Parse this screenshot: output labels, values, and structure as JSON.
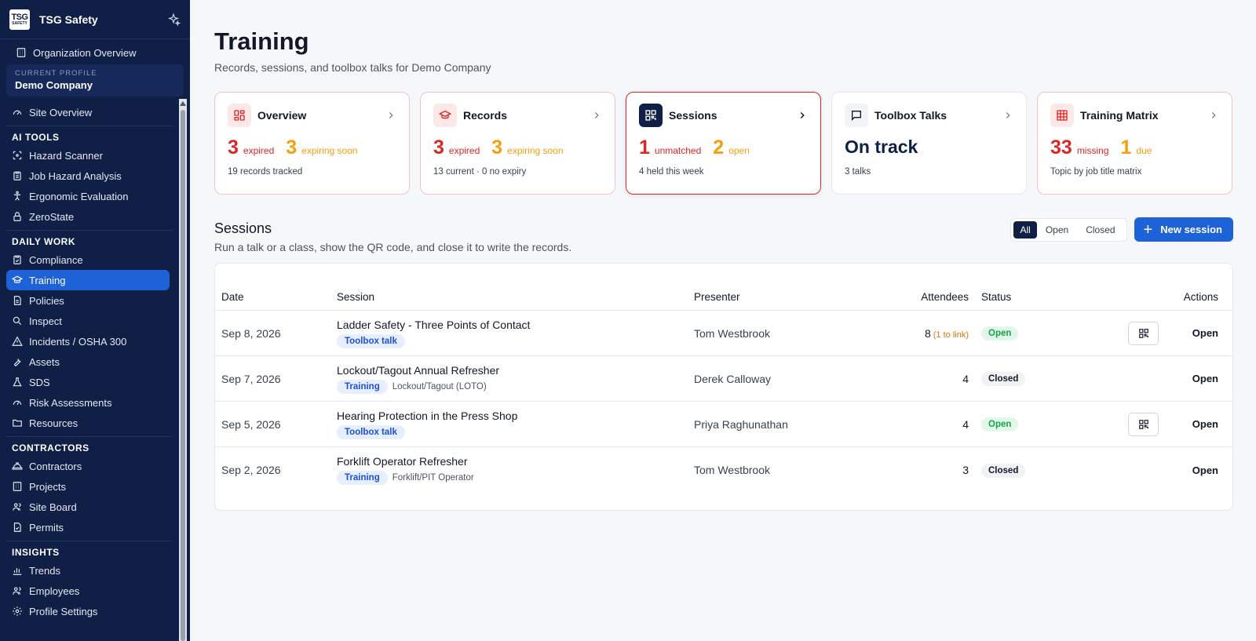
{
  "sidebar": {
    "brand_logo_top": "TSG",
    "brand_logo_bottom": "SAFETY",
    "brand_name": "TSG Safety",
    "org_overview": "Organization Overview",
    "profile_label": "CURRENT PROFILE",
    "profile_name": "Demo Company",
    "site_overview": "Site Overview",
    "sections": {
      "ai_tools": "AI TOOLS",
      "daily_work": "DAILY WORK",
      "contractors": "CONTRACTORS",
      "insights": "INSIGHTS"
    },
    "items": {
      "hazard_scanner": "Hazard Scanner",
      "job_hazard": "Job Hazard Analysis",
      "ergonomic": "Ergonomic Evaluation",
      "zerostate": "ZeroState",
      "compliance": "Compliance",
      "training": "Training",
      "policies": "Policies",
      "inspect": "Inspect",
      "incidents": "Incidents / OSHA 300",
      "assets": "Assets",
      "sds": "SDS",
      "risk": "Risk Assessments",
      "resources": "Resources",
      "contractors": "Contractors",
      "projects": "Projects",
      "site_board": "Site Board",
      "permits": "Permits",
      "trends": "Trends",
      "employees": "Employees",
      "profile_settings": "Profile Settings"
    }
  },
  "page": {
    "title": "Training",
    "subtitle": "Records, sessions, and toolbox talks for Demo Company"
  },
  "cards": {
    "overview": {
      "title": "Overview",
      "n1": "3",
      "l1": "expired",
      "n2": "3",
      "l2": "expiring soon",
      "foot": "19 records tracked"
    },
    "records": {
      "title": "Records",
      "n1": "3",
      "l1": "expired",
      "n2": "3",
      "l2": "expiring soon",
      "foot": "13 current · 0 no expiry"
    },
    "sessions": {
      "title": "Sessions",
      "n1": "1",
      "l1": "unmatched",
      "n2": "2",
      "l2": "open",
      "foot": "4 held this week"
    },
    "toolbox": {
      "title": "Toolbox Talks",
      "status": "On track",
      "foot": "3 talks"
    },
    "matrix": {
      "title": "Training Matrix",
      "n1": "33",
      "l1": "missing",
      "n2": "1",
      "l2": "due",
      "foot": "Topic by job title matrix"
    }
  },
  "sessions": {
    "title": "Sessions",
    "subtitle": "Run a talk or a class, show the QR code, and close it to write the records.",
    "filters": {
      "all": "All",
      "open": "Open",
      "closed": "Closed"
    },
    "new_button": "New session",
    "columns": {
      "date": "Date",
      "session": "Session",
      "presenter": "Presenter",
      "attendees": "Attendees",
      "status": "Status",
      "actions": "Actions"
    },
    "rows": [
      {
        "date": "Sep 8, 2026",
        "title": "Ladder Safety - Three Points of Contact",
        "tag": "Toolbox talk",
        "extra": "",
        "presenter": "Tom Westbrook",
        "attendees": "8",
        "link_note": "(1 to link)",
        "status": "Open",
        "action": "Open"
      },
      {
        "date": "Sep 7, 2026",
        "title": "Lockout/Tagout Annual Refresher",
        "tag": "Training",
        "extra": "Lockout/Tagout (LOTO)",
        "presenter": "Derek Calloway",
        "attendees": "4",
        "link_note": "",
        "status": "Closed",
        "action": "Open"
      },
      {
        "date": "Sep 5, 2026",
        "title": "Hearing Protection in the Press Shop",
        "tag": "Toolbox talk",
        "extra": "",
        "presenter": "Priya Raghunathan",
        "attendees": "4",
        "link_note": "",
        "status": "Open",
        "action": "Open"
      },
      {
        "date": "Sep 2, 2026",
        "title": "Forklift Operator Refresher",
        "tag": "Training",
        "extra": "Forklift/PIT Operator",
        "presenter": "Tom Westbrook",
        "attendees": "3",
        "link_note": "",
        "status": "Closed",
        "action": "Open"
      }
    ]
  },
  "colors": {
    "sidebar_bg": "#0f1f45",
    "accent_blue": "#1d62d6",
    "danger_red": "#dc2626",
    "warning_amber": "#f59e0b",
    "success_green": "#15a34a"
  }
}
